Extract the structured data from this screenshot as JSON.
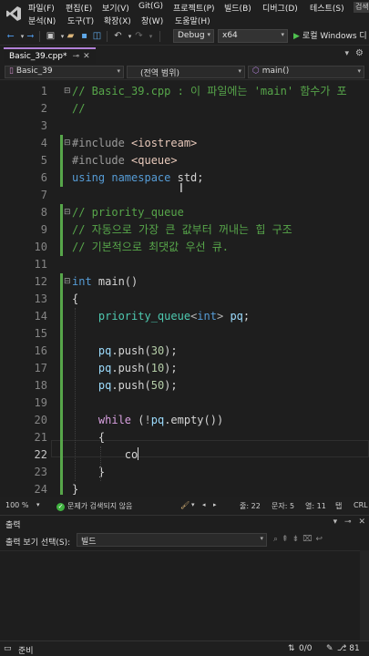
{
  "menu": {
    "row1": [
      "파일(F)",
      "편집(E)",
      "보기(V)",
      "Git(G)",
      "프로젝트(P)",
      "빌드(B)",
      "디버그(D)",
      "테스트(S)"
    ],
    "row2": [
      "분석(N)",
      "도구(T)",
      "확장(X)",
      "창(W)",
      "도움말(H)"
    ],
    "search_label": "검색"
  },
  "toolbar": {
    "config": "Debug",
    "platform": "x64",
    "run_label": "로컬 Windows 디"
  },
  "tab": {
    "title": "Basic_39.cpp*",
    "pin_icon": "pin-icon",
    "close_icon": "close-icon"
  },
  "navbar": {
    "project": "Basic_39",
    "scope": "(전역 범위)",
    "member": "main()"
  },
  "editor": {
    "current_line": 22,
    "lines": [
      {
        "n": "1",
        "tokens": [
          [
            "c-comment",
            "// Basic_39.cpp : 이 파일에는 'main' 함수가 포"
          ]
        ]
      },
      {
        "n": "2",
        "tokens": [
          [
            "c-comment",
            "//"
          ]
        ]
      },
      {
        "n": "3",
        "tokens": []
      },
      {
        "n": "4",
        "tokens": [
          [
            "c-prep",
            "#include "
          ],
          [
            "c-header",
            "<iostream>"
          ]
        ]
      },
      {
        "n": "5",
        "tokens": [
          [
            "c-prep",
            "#include "
          ],
          [
            "c-header",
            "<queue>"
          ]
        ]
      },
      {
        "n": "6",
        "tokens": [
          [
            "c-keyword",
            "using namespace "
          ],
          [
            "c-ident",
            "std;"
          ]
        ]
      },
      {
        "n": "7",
        "tokens": []
      },
      {
        "n": "8",
        "tokens": [
          [
            "c-comment",
            "// priority_queue"
          ]
        ]
      },
      {
        "n": "9",
        "tokens": [
          [
            "c-comment",
            "// 자동으로 가장 큰 값부터 꺼내는 힙 구조"
          ]
        ]
      },
      {
        "n": "10",
        "tokens": [
          [
            "c-comment",
            "// 기본적으로 최댓값 우선 큐."
          ]
        ]
      },
      {
        "n": "11",
        "tokens": []
      },
      {
        "n": "12",
        "tokens": [
          [
            "c-keyword",
            "int "
          ],
          [
            "c-ident",
            "main()"
          ]
        ]
      },
      {
        "n": "13",
        "tokens": [
          [
            "c-ident",
            "{"
          ]
        ]
      },
      {
        "n": "14",
        "tokens": [
          [
            "c-ident",
            "    "
          ],
          [
            "c-type",
            "priority_queue"
          ],
          [
            "c-op",
            "<"
          ],
          [
            "c-keyword",
            "int"
          ],
          [
            "c-op",
            "> "
          ],
          [
            "c-var",
            "pq"
          ],
          [
            "c-ident",
            ";"
          ]
        ]
      },
      {
        "n": "15",
        "tokens": []
      },
      {
        "n": "16",
        "tokens": [
          [
            "c-ident",
            "    "
          ],
          [
            "c-var",
            "pq"
          ],
          [
            "c-ident",
            ".push("
          ],
          [
            "c-num",
            "30"
          ],
          [
            "c-ident",
            ");"
          ]
        ]
      },
      {
        "n": "17",
        "tokens": [
          [
            "c-ident",
            "    "
          ],
          [
            "c-var",
            "pq"
          ],
          [
            "c-ident",
            ".push("
          ],
          [
            "c-num",
            "10"
          ],
          [
            "c-ident",
            ");"
          ]
        ]
      },
      {
        "n": "18",
        "tokens": [
          [
            "c-ident",
            "    "
          ],
          [
            "c-var",
            "pq"
          ],
          [
            "c-ident",
            ".push("
          ],
          [
            "c-num",
            "50"
          ],
          [
            "c-ident",
            ");"
          ]
        ]
      },
      {
        "n": "19",
        "tokens": []
      },
      {
        "n": "20",
        "tokens": [
          [
            "c-ident",
            "    "
          ],
          [
            "c-ctrl",
            "while "
          ],
          [
            "c-ident",
            "("
          ],
          [
            "c-op",
            "!"
          ],
          [
            "c-var",
            "pq"
          ],
          [
            "c-ident",
            ".empty())"
          ]
        ]
      },
      {
        "n": "21",
        "tokens": [
          [
            "c-ident",
            "    {"
          ]
        ]
      },
      {
        "n": "22",
        "tokens": [
          [
            "c-ident",
            "        co"
          ]
        ]
      },
      {
        "n": "23",
        "tokens": [
          [
            "c-ident",
            "    }"
          ]
        ]
      },
      {
        "n": "24",
        "tokens": [
          [
            "c-ident",
            "}"
          ]
        ]
      }
    ]
  },
  "editor_status": {
    "zoom": "100 %",
    "issues": "문제가 검색되지 않음",
    "line": "줄: 22",
    "char": "문자: 5",
    "col": "열: 11",
    "ins": "탭",
    "eol": "CRL"
  },
  "output": {
    "title": "출력",
    "source_label": "출력 보기 선택(S):",
    "source_value": "빌드"
  },
  "statusbar": {
    "ready": "준비",
    "changes": "0/0",
    "edits": "81"
  },
  "colors": {
    "accent": "#b180d7",
    "changebar": "#57a64a",
    "run": "#4fc14f"
  }
}
